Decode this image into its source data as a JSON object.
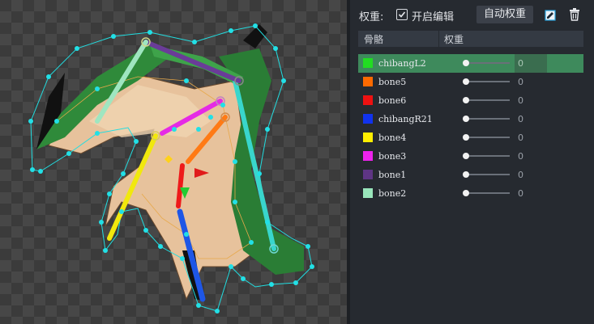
{
  "panel": {
    "weight_label": "权重:",
    "edit_checked": true,
    "edit_label": "开启编辑",
    "auto_weight_button": "自动权重",
    "icons": {
      "edit": "edit-icon",
      "delete": "trash-icon"
    }
  },
  "table": {
    "headers": {
      "bone": "骨骼",
      "weight": "权重"
    },
    "rows": [
      {
        "name": "chibangL2",
        "color": "#22dd22",
        "weight": "0",
        "selected": true
      },
      {
        "name": "bone5",
        "color": "#ff6a00",
        "weight": "0"
      },
      {
        "name": "bone6",
        "color": "#ee1111",
        "weight": "0"
      },
      {
        "name": "chibangR21",
        "color": "#1133ee",
        "weight": "0"
      },
      {
        "name": "bone4",
        "color": "#ffee00",
        "weight": "0"
      },
      {
        "name": "bone3",
        "color": "#ee22ee",
        "weight": "0"
      },
      {
        "name": "bone1",
        "color": "#5e3584",
        "weight": "0"
      },
      {
        "name": "bone2",
        "color": "#99e6bb",
        "weight": "0"
      }
    ]
  },
  "colors": {
    "selected_row": "#3e8a5c",
    "mesh": "#22dde0",
    "panel_bg": "#262a30"
  }
}
